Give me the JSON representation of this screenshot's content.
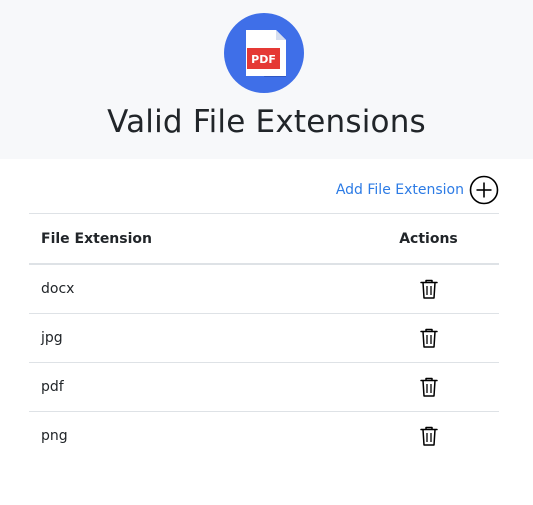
{
  "header": {
    "logo_text": "PDF",
    "logo_icon": "pdf-file-icon",
    "title": "Valid File Extensions"
  },
  "toolbar": {
    "add_label": "Add File Extension",
    "add_icon": "plus-circle-icon"
  },
  "table": {
    "columns": [
      "File Extension",
      "Actions"
    ],
    "rows": [
      {
        "extension": "docx",
        "action_icon": "trash-icon"
      },
      {
        "extension": "jpg",
        "action_icon": "trash-icon"
      },
      {
        "extension": "pdf",
        "action_icon": "trash-icon"
      },
      {
        "extension": "png",
        "action_icon": "trash-icon"
      }
    ]
  },
  "colors": {
    "accent": "#2c7be5",
    "logo_blue": "#3f6fe8",
    "logo_red": "#e53935",
    "header_bg": "#f7f8fa",
    "border": "#dee2e6"
  }
}
